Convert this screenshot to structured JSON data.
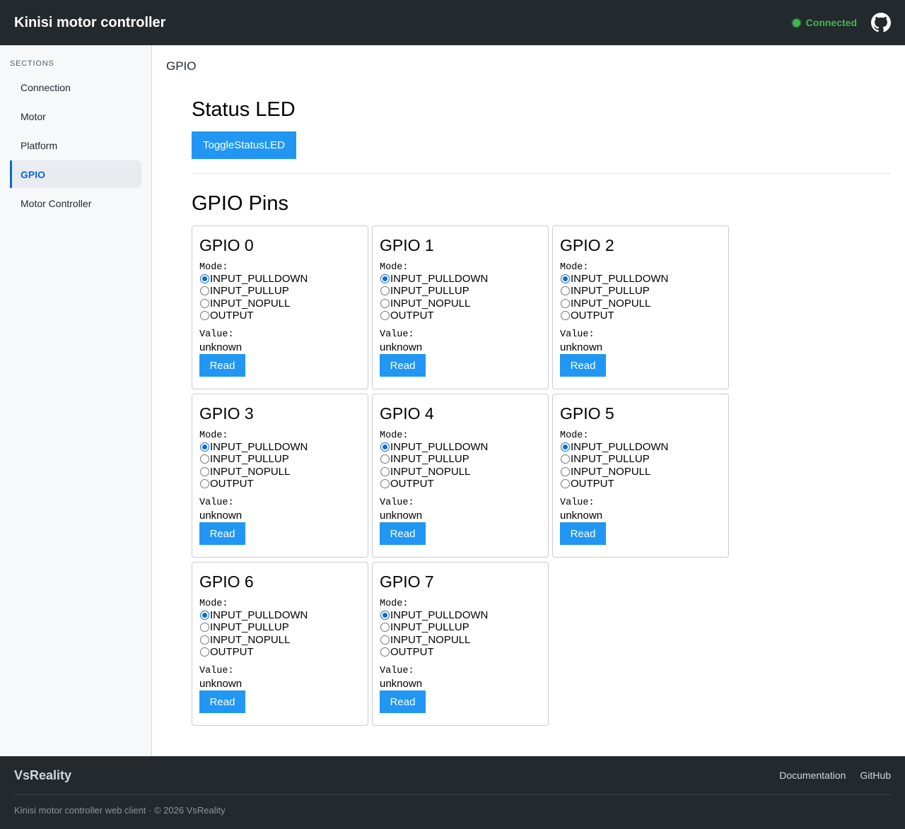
{
  "header": {
    "title": "Kinisi motor controller",
    "status_label": "Connected",
    "status_color": "#3fb950",
    "github_icon": "github-icon"
  },
  "sidebar": {
    "heading": "SECTIONS",
    "items": [
      {
        "label": "Connection",
        "active": false
      },
      {
        "label": "Motor",
        "active": false
      },
      {
        "label": "Platform",
        "active": false
      },
      {
        "label": "GPIO",
        "active": true
      },
      {
        "label": "Motor Controller",
        "active": false
      }
    ]
  },
  "main": {
    "breadcrumb": "GPIO",
    "status_led": {
      "title": "Status LED",
      "button_label": "ToggleStatusLED"
    },
    "gpio_section_title": "GPIO Pins",
    "mode_label": "Mode:",
    "value_label": "Value:",
    "read_label": "Read",
    "mode_options": [
      "INPUT_PULLDOWN",
      "INPUT_PULLUP",
      "INPUT_NOPULL",
      "OUTPUT"
    ],
    "pins": [
      {
        "title": "GPIO 0",
        "selected_mode": "INPUT_PULLDOWN",
        "value": "unknown"
      },
      {
        "title": "GPIO 1",
        "selected_mode": "INPUT_PULLDOWN",
        "value": "unknown"
      },
      {
        "title": "GPIO 2",
        "selected_mode": "INPUT_PULLDOWN",
        "value": "unknown"
      },
      {
        "title": "GPIO 3",
        "selected_mode": "INPUT_PULLDOWN",
        "value": "unknown"
      },
      {
        "title": "GPIO 4",
        "selected_mode": "INPUT_PULLDOWN",
        "value": "unknown"
      },
      {
        "title": "GPIO 5",
        "selected_mode": "INPUT_PULLDOWN",
        "value": "unknown"
      },
      {
        "title": "GPIO 6",
        "selected_mode": "INPUT_PULLDOWN",
        "value": "unknown"
      },
      {
        "title": "GPIO 7",
        "selected_mode": "INPUT_PULLDOWN",
        "value": "unknown"
      }
    ]
  },
  "footer": {
    "brand": "VsReality",
    "links": [
      "Documentation",
      "GitHub"
    ],
    "copyright": "Kinisi motor controller web client · © 2026 VsReality"
  },
  "colors": {
    "accent": "#2196f3",
    "nav_active": "#0969da",
    "header_bg": "#24292e"
  }
}
